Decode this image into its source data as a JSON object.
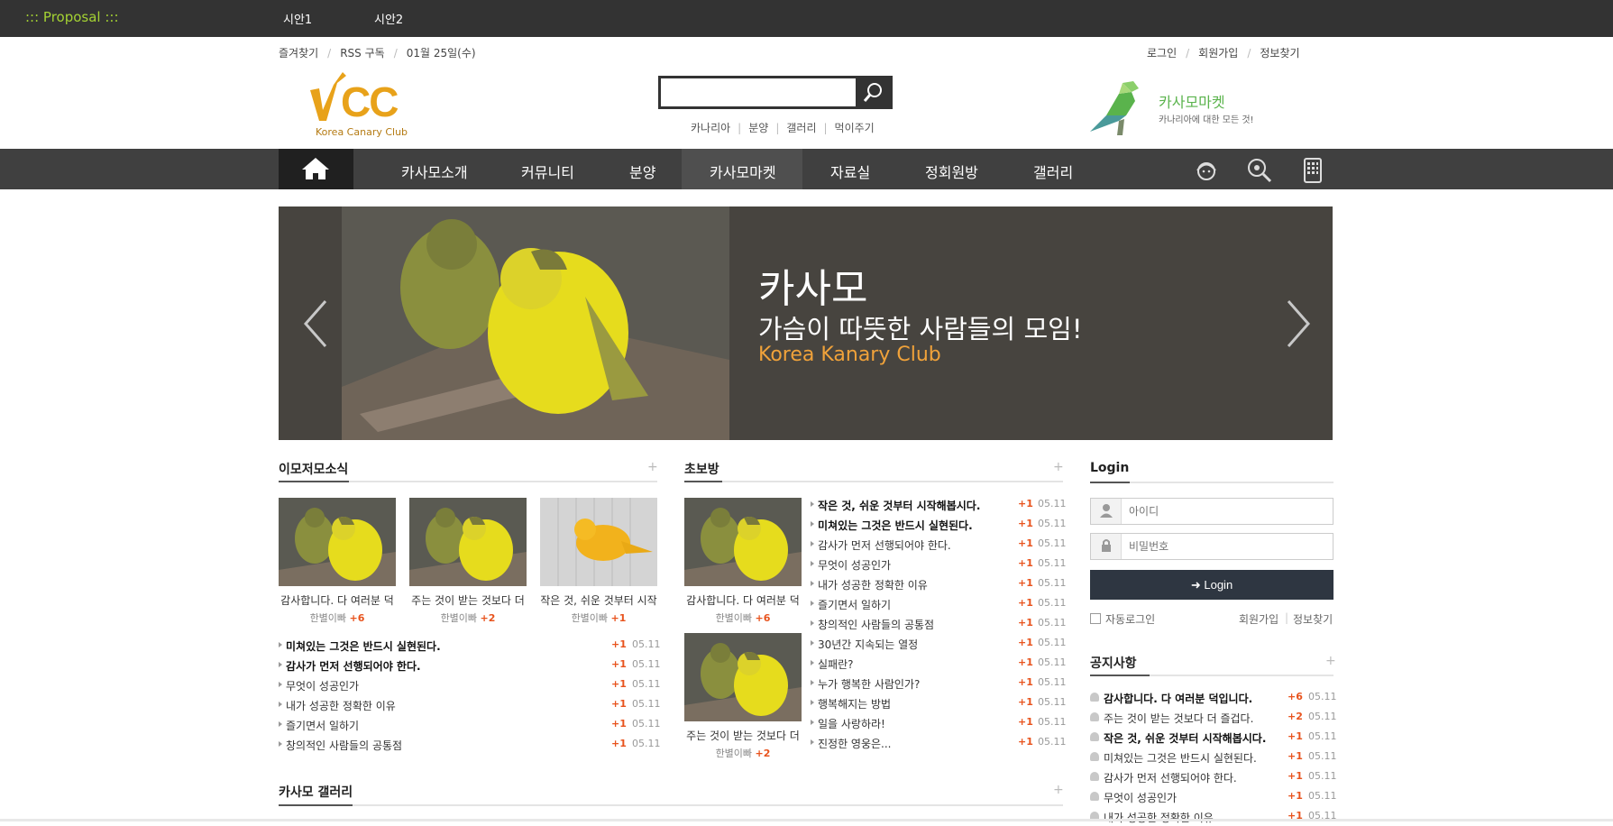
{
  "topbar": {
    "brand": "::: Proposal :::",
    "tabs": [
      "시안1",
      "시안2"
    ]
  },
  "util_left": [
    "즐겨찾기",
    "RSS 구독",
    "01월 25일(수)"
  ],
  "util_right": [
    "로그인",
    "회원가입",
    "정보찾기"
  ],
  "logo": {
    "mark": "CC",
    "sub": "Korea Canary Club"
  },
  "search": {
    "value": "",
    "placeholder": ""
  },
  "quick_links": [
    "카나리아",
    "분양",
    "갤러리",
    "먹이주기"
  ],
  "market": {
    "title": "카사모마켓",
    "subtitle": "카나리아에 대한 모든 것!"
  },
  "nav": [
    "카사모소개",
    "커뮤니티",
    "분양",
    "카사모마켓",
    "자료실",
    "정회원방",
    "갤러리"
  ],
  "banner": {
    "title1": "카사모",
    "title2": "가슴이 따뜻한 사람들의 모임!",
    "title3": "Korea Kanary Club"
  },
  "section1": {
    "title": "이모저모소식",
    "plus": "+",
    "thumbs": [
      {
        "caption": "감사합니다. 다 여러분 덕",
        "author": "한별이빠",
        "count": "+6"
      },
      {
        "caption": "주는 것이 받는 것보다 더",
        "author": "한별이빠",
        "count": "+2"
      },
      {
        "caption": "작은 것, 쉬운 것부터 시작",
        "author": "한별이빠",
        "count": "+1"
      }
    ],
    "rows": [
      {
        "text": "미쳐있는 그것은 반드시 실현된다.",
        "bold": true,
        "count": "+1",
        "date": "05.11"
      },
      {
        "text": "감사가 먼저 선행되어야 한다.",
        "bold": true,
        "count": "+1",
        "date": "05.11"
      },
      {
        "text": "무엇이 성공인가",
        "bold": false,
        "count": "+1",
        "date": "05.11"
      },
      {
        "text": "내가 성공한 정확한 이유",
        "bold": false,
        "count": "+1",
        "date": "05.11"
      },
      {
        "text": "즐기면서 일하기",
        "bold": false,
        "count": "+1",
        "date": "05.11"
      },
      {
        "text": "창의적인 사람들의 공통점",
        "bold": false,
        "count": "+1",
        "date": "05.11"
      }
    ]
  },
  "section2": {
    "title": "초보방",
    "plus": "+",
    "thumbs": [
      {
        "caption": "감사합니다. 다 여러분 덕",
        "author": "한별이빠",
        "count": "+6"
      },
      {
        "caption": "주는 것이 받는 것보다 더",
        "author": "한별이빠",
        "count": "+2"
      }
    ],
    "rows": [
      {
        "text": "작은 것, 쉬운 것부터 시작해봅시다.",
        "bold": true,
        "count": "+1",
        "date": "05.11"
      },
      {
        "text": "미쳐있는 그것은 반드시 실현된다.",
        "bold": true,
        "count": "+1",
        "date": "05.11"
      },
      {
        "text": "감사가 먼저 선행되어야 한다.",
        "bold": false,
        "count": "+1",
        "date": "05.11"
      },
      {
        "text": "무엇이 성공인가",
        "bold": false,
        "count": "+1",
        "date": "05.11"
      },
      {
        "text": "내가 성공한 정확한 이유",
        "bold": false,
        "count": "+1",
        "date": "05.11"
      },
      {
        "text": "즐기면서 일하기",
        "bold": false,
        "count": "+1",
        "date": "05.11"
      },
      {
        "text": "창의적인 사람들의 공통점",
        "bold": false,
        "count": "+1",
        "date": "05.11"
      },
      {
        "text": "30년간 지속되는 열정",
        "bold": false,
        "count": "+1",
        "date": "05.11"
      },
      {
        "text": "실패란?",
        "bold": false,
        "count": "+1",
        "date": "05.11"
      },
      {
        "text": "누가 행복한 사람인가?",
        "bold": false,
        "count": "+1",
        "date": "05.11"
      },
      {
        "text": "행복해지는 방법",
        "bold": false,
        "count": "+1",
        "date": "05.11"
      },
      {
        "text": "일을 사랑하라!",
        "bold": false,
        "count": "+1",
        "date": "05.11"
      },
      {
        "text": "진정한 영웅은...",
        "bold": false,
        "count": "+1",
        "date": "05.11"
      }
    ]
  },
  "gallery": {
    "title": "카사모 갤러리",
    "plus": "+"
  },
  "login": {
    "title": "Login",
    "id_placeholder": "아이디",
    "pw_placeholder": "비밀번호",
    "button": "Login",
    "auto": "자동로그인",
    "join": "회원가입",
    "find": "정보찾기"
  },
  "notice": {
    "title": "공지사항",
    "plus": "+",
    "rows": [
      {
        "text": "감사합니다. 다 여러분 덕입니다.",
        "bold": true,
        "count": "+6",
        "date": "05.11"
      },
      {
        "text": "주는 것이 받는 것보다 더 즐겁다.",
        "bold": false,
        "count": "+2",
        "date": "05.11"
      },
      {
        "text": "작은 것, 쉬운 것부터 시작해봅시다.",
        "bold": true,
        "count": "+1",
        "date": "05.11"
      },
      {
        "text": "미쳐있는 그것은 반드시 실현된다.",
        "bold": false,
        "count": "+1",
        "date": "05.11"
      },
      {
        "text": "감사가 먼저 선행되어야 한다.",
        "bold": false,
        "count": "+1",
        "date": "05.11"
      },
      {
        "text": "무엇이 성공인가",
        "bold": false,
        "count": "+1",
        "date": "05.11"
      },
      {
        "text": "내가 성공한 정확한 이유",
        "bold": false,
        "count": "+1",
        "date": "05.11"
      }
    ]
  },
  "colors": {
    "accent_orange": "#e8531d",
    "market_green": "#5ab34c",
    "brand_green": "#a4d233"
  }
}
